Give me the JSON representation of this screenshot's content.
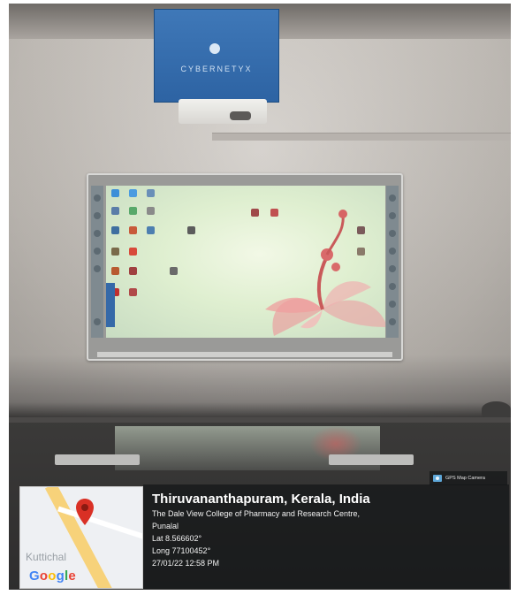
{
  "projector": {
    "brand": "CYBERNETYX"
  },
  "gps_overlay": {
    "badge_label": "GPS Map Camera",
    "icon": "camera-icon",
    "city": "Thiruvananthapuram, Kerala, India",
    "address_line1": "The Dale View College of Pharmacy and Research Centre,",
    "address_line2": "Punalal",
    "latitude": "Lat 8.566602°",
    "longitude": "Long 77100452°",
    "timestamp": "27/01/22 12:58 PM"
  },
  "map": {
    "place_label": "Kuttichal",
    "logo_text": [
      "G",
      "o",
      "o",
      "g",
      "l",
      "e"
    ],
    "logo_colors": [
      "#4285F4",
      "#EA4335",
      "#FBBC05",
      "#4285F4",
      "#34A853",
      "#EA4335"
    ],
    "pin_color": "#d93025",
    "pin_icon": "map-pin-icon"
  }
}
